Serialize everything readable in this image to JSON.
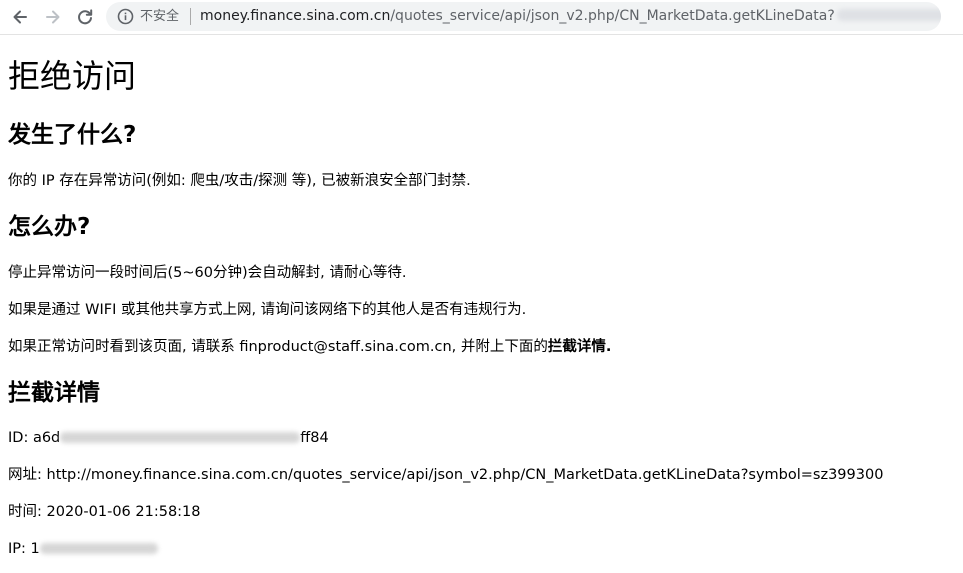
{
  "browser": {
    "security_label": "不安全",
    "url_host": "money.finance.sina.com.cn",
    "url_path": "/quotes_service/api/json_v2.php/CN_MarketData.getKLineData?"
  },
  "page": {
    "title": "拒绝访问",
    "section_what": {
      "heading": "发生了什么?",
      "text": "你的 IP 存在异常访问(例如: 爬虫/攻击/探测 等), 已被新浪安全部门封禁."
    },
    "section_how": {
      "heading": "怎么办?",
      "line1": "停止异常访问一段时间后(5~60分钟)会自动解封, 请耐心等待.",
      "line2": "如果是通过 WIFI 或其他共享方式上网, 请询问该网络下的其他人是否有违规行为.",
      "line3_prefix": "如果正常访问时看到该页面, 请联系 finproduct@staff.sina.com.cn, 并附上下面的",
      "line3_bold": "拦截详情."
    },
    "section_details": {
      "heading": "拦截详情",
      "id_label": "ID: ",
      "id_start": "a6d",
      "id_end": "ff84",
      "url_label": "网址: ",
      "url_value": "http://money.finance.sina.com.cn/quotes_service/api/json_v2.php/CN_MarketData.getKLineData?symbol=sz399300",
      "time_label": "时间: ",
      "time_value": "2020-01-06 21:58:18",
      "ip_label": "IP: ",
      "ip_start": "1"
    }
  }
}
